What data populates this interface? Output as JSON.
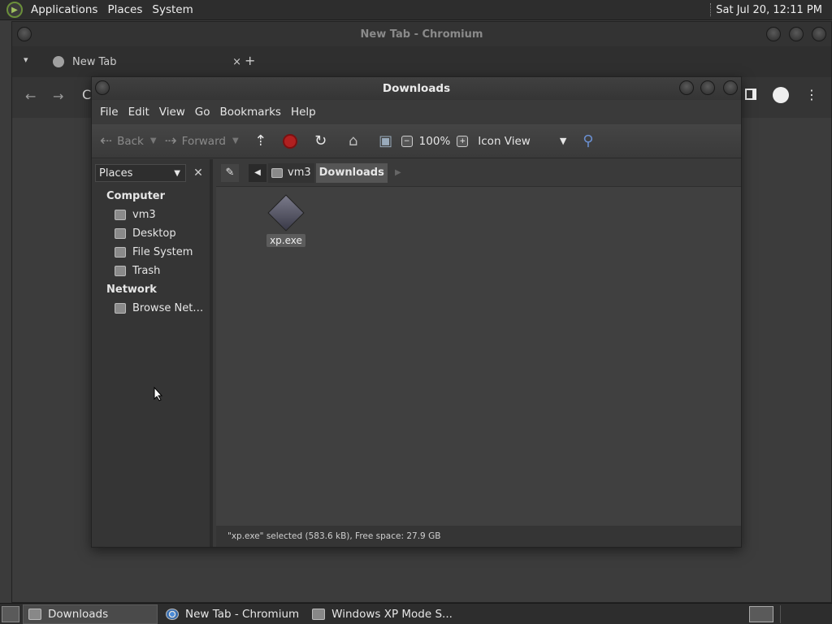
{
  "top_panel": {
    "menus": [
      "Applications",
      "Places",
      "System"
    ],
    "clock": "Sat Jul 20, 12:11 PM"
  },
  "chromium": {
    "title": "New Tab - Chromium",
    "tab_label": "New Tab",
    "tab_close": "×",
    "new_tab": "+"
  },
  "file_manager": {
    "title": "Downloads",
    "menu": [
      "File",
      "Edit",
      "View",
      "Go",
      "Bookmarks",
      "Help"
    ],
    "toolbar": {
      "back_label": "Back",
      "forward_label": "Forward",
      "zoom": "100%",
      "view_mode": "Icon View"
    },
    "sidebar": {
      "selector": "Places",
      "computer_header": "Computer",
      "computer_items": [
        "vm3",
        "Desktop",
        "File System",
        "Trash"
      ],
      "network_header": "Network",
      "network_items": [
        "Browse Net…"
      ]
    },
    "pathbar": {
      "crumbs": [
        "vm3",
        "Downloads"
      ]
    },
    "files": [
      {
        "name": "xp.exe",
        "selected": true
      }
    ],
    "status": "\"xp.exe\" selected (583.6 kB), Free space: 27.9 GB"
  },
  "taskbar": {
    "tasks": [
      "Downloads",
      "New Tab - Chromium",
      "Windows XP Mode S..."
    ]
  }
}
